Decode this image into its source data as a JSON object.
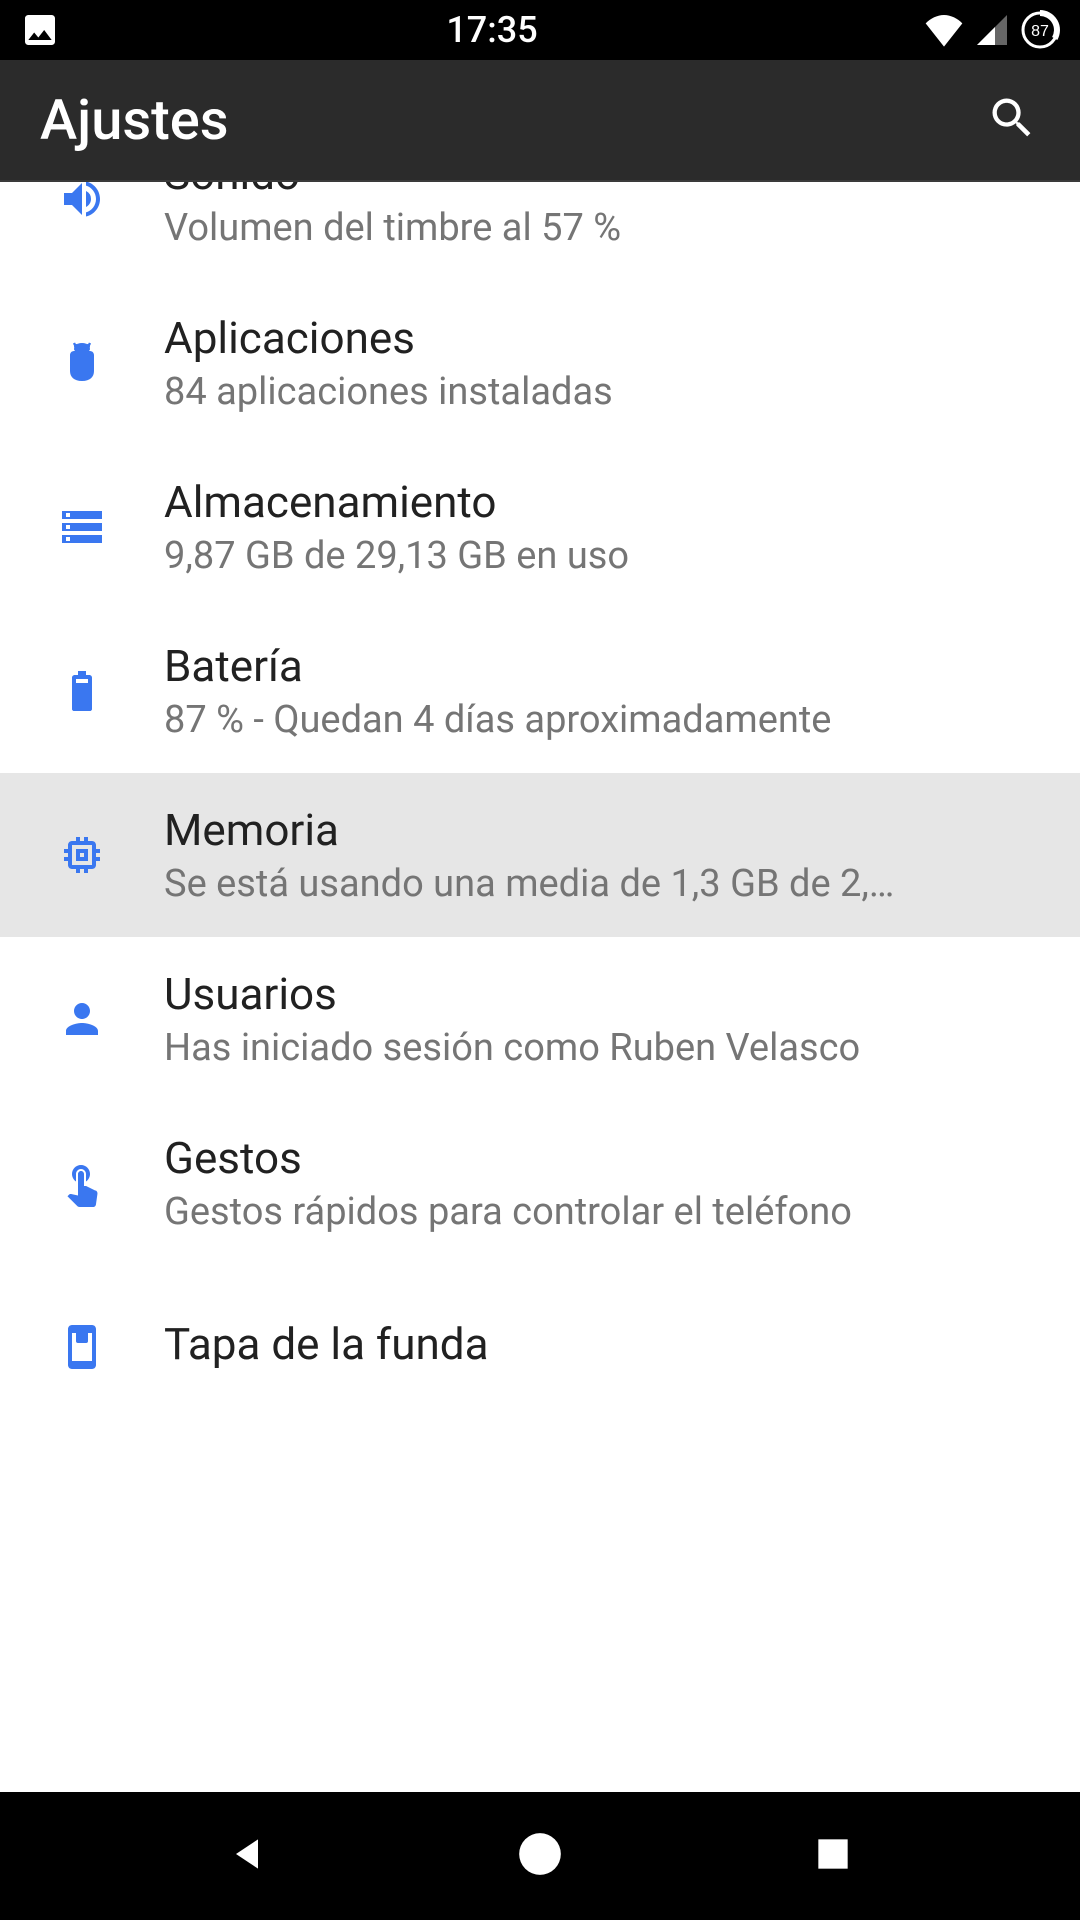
{
  "status": {
    "time": "17:35",
    "battery": "87"
  },
  "header": {
    "title": "Ajustes"
  },
  "items": [
    {
      "title": "Sonido",
      "sub": "Volumen del timbre al 57 %"
    },
    {
      "title": "Aplicaciones",
      "sub": "84 aplicaciones instaladas"
    },
    {
      "title": "Almacenamiento",
      "sub": "9,87 GB de 29,13 GB en uso"
    },
    {
      "title": "Batería",
      "sub": "87 % - Quedan 4 días aproximadamente"
    },
    {
      "title": "Memoria",
      "sub": "Se está usando una media de 1,3 GB de 2,…"
    },
    {
      "title": "Usuarios",
      "sub": "Has iniciado sesión como Ruben Velasco"
    },
    {
      "title": "Gestos",
      "sub": "Gestos rápidos para controlar el teléfono"
    },
    {
      "title": "Tapa de la funda",
      "sub": ""
    }
  ]
}
